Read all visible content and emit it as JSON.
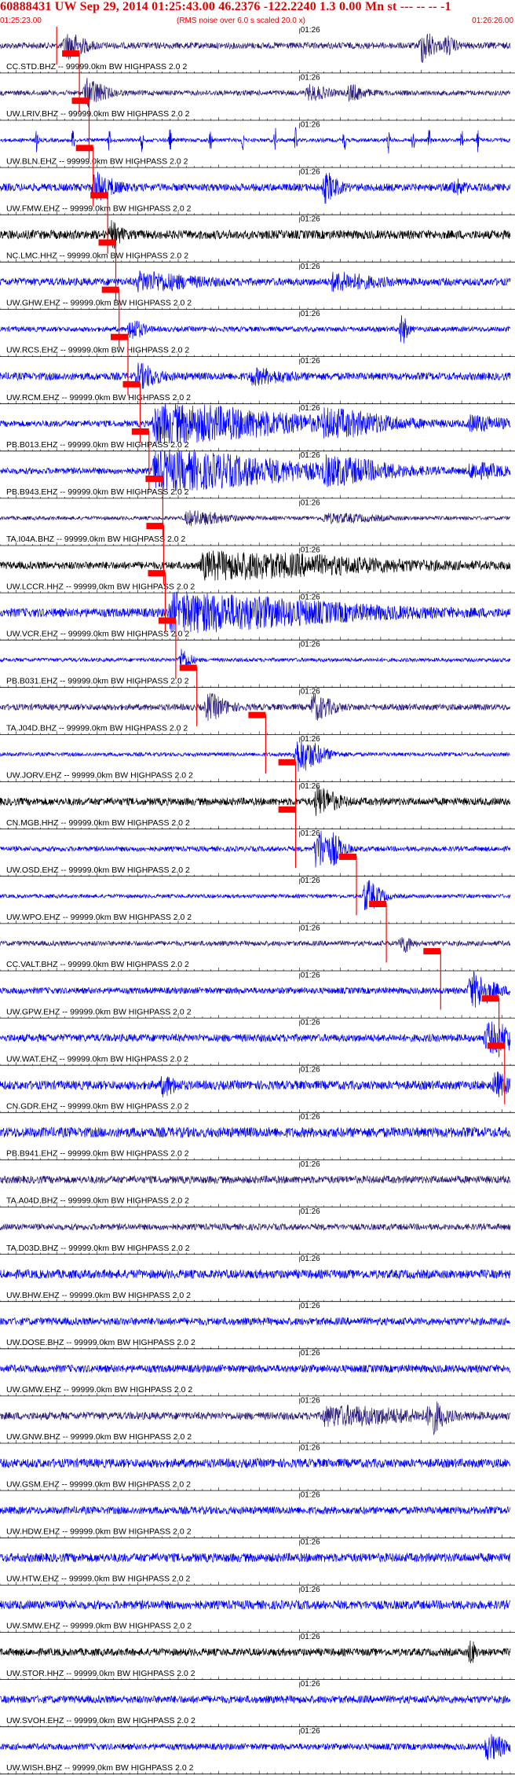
{
  "header": {
    "title": "60888431 UW Sep 29, 2014 01:25:43.00   46.2376 -122.2240  1.3 0.00 Mn st --- -- --  -1",
    "start_time": "01:25:23.00",
    "scale_note": "(RMS noise over 6.0 s scaled 20.0 x)",
    "end_time": "01:26:26.00"
  },
  "chart_data": {
    "type": "line",
    "title": "60888431 UW Sep 29, 2014 01:25:43.00   46.2376 -122.2240  1.3 0.00 Mn st --- -- --  -1",
    "x_start": "01:25:23.00",
    "x_end": "01:26:26.00",
    "x_range_seconds": [
      0,
      63
    ],
    "minute_mark_label": "01:26",
    "minute_mark_seconds": 37,
    "grid": false,
    "colors": {
      "black": "#000000",
      "blue": "#0000ff",
      "navy": "#2a1a7a",
      "pick": "#ff0000",
      "label": "#000000"
    },
    "series": [
      {
        "name": "CC.STD.BHZ -- 99999.0km BW HIGHPASS 2.0 2",
        "color": "navy",
        "pick_s": 7.0,
        "amp": 0.25,
        "bursts": [
          [
            8,
            3,
            0.9
          ],
          [
            52,
            2,
            1.2
          ],
          [
            55,
            1.5,
            0.6
          ]
        ]
      },
      {
        "name": "UW.LRIV.BHZ -- 99999.0km BW HIGHPASS 2.0 2",
        "color": "navy",
        "pick_s": 9.8,
        "amp": 0.2,
        "bursts": [
          [
            10.5,
            3,
            1.0
          ],
          [
            38,
            3,
            0.5
          ],
          [
            43,
            2.5,
            0.55
          ]
        ]
      },
      {
        "name": "UW.BLN.EHZ -- 99999.0km BW HIGHPASS 2.0 2",
        "color": "blue",
        "pick_s": 11.0,
        "amp": 0.15,
        "spikes": [
          4.5,
          9,
          13.5,
          17.5,
          21,
          26,
          30,
          34,
          36.5,
          42.5,
          48,
          51,
          53,
          57,
          59
        ]
      },
      {
        "name": "UW.FMW.EHZ -- 99999.0km BW HIGHPASS 2.0 2",
        "color": "blue",
        "pick_s": 11.5,
        "amp": 0.3,
        "bursts": [
          [
            11.5,
            3,
            1.0
          ],
          [
            40,
            2,
            1.0
          ],
          [
            56,
            1.5,
            0.5
          ]
        ]
      },
      {
        "name": "NC.LMC.HHZ -- 99999.0km BW HIGHPASS 2.0 2",
        "color": "black",
        "pick_s": 13.3,
        "amp": 0.35,
        "bursts": [
          [
            13.7,
            1.5,
            0.8
          ]
        ]
      },
      {
        "name": "UW.GHW.EHZ -- 99999.0km BW HIGHPASS 2.0 2",
        "color": "blue",
        "pick_s": 14.3,
        "amp": 0.3,
        "bursts": [
          [
            17,
            8,
            0.6
          ],
          [
            41,
            6,
            0.55
          ]
        ]
      },
      {
        "name": "UW.RCS.EHZ -- 99999.0km BW HIGHPASS 2.0 2",
        "color": "blue",
        "pick_s": 14.7,
        "amp": 0.2,
        "bursts": [
          [
            16,
            2,
            0.8
          ],
          [
            49.5,
            1,
            1.1
          ]
        ]
      },
      {
        "name": "UW.RCM.EHZ -- 99999.0km BW HIGHPASS 2.0 2",
        "color": "blue",
        "pick_s": 15.8,
        "amp": 0.3,
        "bursts": [
          [
            17,
            3,
            0.8
          ],
          [
            31,
            5,
            0.45
          ]
        ]
      },
      {
        "name": "PB.B013.EHZ -- 99999.0km BW HIGHPASS 2.0 2",
        "color": "blue",
        "pick_s": 17.3,
        "amp": 0.25,
        "bursts": [
          [
            19,
            22,
            1.4
          ],
          [
            40,
            10,
            0.7
          ],
          [
            58,
            5,
            0.5
          ]
        ]
      },
      {
        "name": "PB.B943.EHZ -- 99999.0km BW HIGHPASS 2.0 2",
        "color": "blue",
        "pick_s": 18.4,
        "amp": 0.25,
        "bursts": [
          [
            19,
            22,
            1.4
          ],
          [
            40,
            10,
            0.7
          ],
          [
            58,
            5,
            0.5
          ]
        ]
      },
      {
        "name": "TA.I04A.BHZ -- 99999.0km BW HIGHPASS 2.0 2",
        "color": "navy",
        "pick_s": 20.1,
        "amp": 0.15,
        "bursts": [
          [
            23,
            6,
            0.5
          ],
          [
            40,
            8,
            0.3
          ]
        ]
      },
      {
        "name": "UW.LCCR.HHZ -- 99999.0km BW HIGHPASS 2.0 2",
        "color": "black",
        "pick_s": 20.2,
        "amp": 0.3,
        "bursts": [
          [
            25,
            25,
            0.9
          ]
        ]
      },
      {
        "name": "UW.VCR.EHZ -- 99999.0km BW HIGHPASS 2.0 2",
        "color": "blue",
        "pick_s": 20.4,
        "amp": 0.35,
        "bursts": [
          [
            21,
            25,
            1.3
          ]
        ]
      },
      {
        "name": "PB.B031.EHZ -- 99999.0km BW HIGHPASS 2.0 2",
        "color": "blue",
        "pick_s": 21.7,
        "amp": 0.15,
        "bursts": [
          [
            22.3,
            1.5,
            0.9
          ]
        ]
      },
      {
        "name": "TA.J04D.BHZ -- 99999.0km BW HIGHPASS 2.0 2",
        "color": "navy",
        "pick_s": 24.3,
        "amp": 0.25,
        "bursts": [
          [
            25.5,
            3,
            0.9
          ],
          [
            38.5,
            3,
            0.9
          ]
        ]
      },
      {
        "name": "UW.JORV.EHZ -- 99999.0km BW HIGHPASS 2.0 2",
        "color": "blue",
        "pick_s": 32.8,
        "amp": 0.15,
        "bursts": [
          [
            36.5,
            4,
            1.3
          ]
        ]
      },
      {
        "name": "CN.MGB.HHZ -- 99999.0km BW HIGHPASS 2.0 2",
        "color": "black",
        "pick_s": 36.5,
        "amp": 0.3,
        "bursts": [
          [
            39,
            3,
            1.0
          ]
        ]
      },
      {
        "name": "UW.OSD.EHZ -- 99999.0km BW HIGHPASS 2.0 2",
        "color": "blue",
        "pick_s": 36.5,
        "amp": 0.2,
        "bursts": [
          [
            39,
            2.5,
            1.6
          ],
          [
            41,
            2,
            0.7
          ]
        ]
      },
      {
        "name": "UW.WPO.EHZ -- 99999.0km BW HIGHPASS 2.0 2",
        "color": "blue",
        "pick_s": 44.0,
        "amp": 0.15,
        "bursts": [
          [
            45,
            2.5,
            1.2
          ]
        ]
      },
      {
        "name": "CC.VALT.BHZ -- 99999.0km BW HIGHPASS 2.0 2",
        "color": "navy",
        "pick_s": 47.7,
        "amp": 0.2,
        "bursts": [
          [
            49.5,
            1.5,
            0.7
          ]
        ]
      },
      {
        "name": "UW.GPW.EHZ -- 99999.0km BW HIGHPASS 2.0 2",
        "color": "blue",
        "pick_s": 54.4,
        "amp": 0.25,
        "bursts": [
          [
            58,
            3.5,
            1.3
          ]
        ]
      },
      {
        "name": "UW.WAT.EHZ -- 99999.0km BW HIGHPASS 2.0 2",
        "color": "blue",
        "pick_s": 61.6,
        "amp": 0.3,
        "bursts": [
          [
            60,
            6,
            1.0
          ]
        ]
      },
      {
        "name": "CN.GDR.EHZ -- 99999.0km BW HIGHPASS 2.0 2",
        "color": "blue",
        "pick_s": 62.3,
        "amp": 0.35,
        "bursts": [
          [
            20,
            2,
            0.6
          ],
          [
            61,
            2,
            0.8
          ]
        ]
      },
      {
        "name": "PB.B941.EHZ -- 99999.0km BW HIGHPASS 2.0 2",
        "color": "blue",
        "amp": 0.4
      },
      {
        "name": "TA.A04D.BHZ -- 99999.0km BW HIGHPASS 2.0 2",
        "color": "navy",
        "amp": 0.3
      },
      {
        "name": "TA.D03D.BHZ -- 99999.0km BW HIGHPASS 2.0 2",
        "color": "navy",
        "amp": 0.25
      },
      {
        "name": "UW.BHW.EHZ -- 99999.0km BW HIGHPASS 2.0 2",
        "color": "blue",
        "amp": 0.35
      },
      {
        "name": "UW.DOSE.BHZ -- 99999.0km BW HIGHPASS 2.0 2",
        "color": "blue",
        "amp": 0.3
      },
      {
        "name": "UW.GMW.EHZ -- 99999.0km BW HIGHPASS 2.0 2",
        "color": "blue",
        "amp": 0.3
      },
      {
        "name": "UW.GNW.BHZ -- 99999.0km BW HIGHPASS 2.0 2",
        "color": "navy",
        "amp": 0.3,
        "bursts": [
          [
            40,
            14,
            0.6
          ],
          [
            53,
            2,
            1.1
          ]
        ]
      },
      {
        "name": "UW.GSM.EHZ -- 99999.0km BW HIGHPASS 2.0 2",
        "color": "blue",
        "amp": 0.35
      },
      {
        "name": "UW.HDW.EHZ -- 99999.0km BW HIGHPASS 2.0 2",
        "color": "blue",
        "amp": 0.3
      },
      {
        "name": "UW.HTW.EHZ -- 99999.0km BW HIGHPASS 2.0 2",
        "color": "blue",
        "amp": 0.35
      },
      {
        "name": "UW.SMW.EHZ -- 99999.0km BW HIGHPASS 2.0 2",
        "color": "blue",
        "amp": 0.35
      },
      {
        "name": "UW.STOR.HHZ -- 99999.0km BW HIGHPASS 2.0 2",
        "color": "black",
        "amp": 0.3,
        "bursts": [
          [
            58,
            0.8,
            0.9
          ]
        ]
      },
      {
        "name": "UW.SVOH.EHZ -- 99999.0km BW HIGHPASS 2.0 2",
        "color": "blue",
        "amp": 0.3
      },
      {
        "name": "UW.WISH.BHZ -- 99999.0km BW HIGHPASS 2.0 2",
        "color": "blue",
        "amp": 0.25,
        "bursts": [
          [
            60,
            3,
            0.9
          ]
        ]
      }
    ]
  }
}
